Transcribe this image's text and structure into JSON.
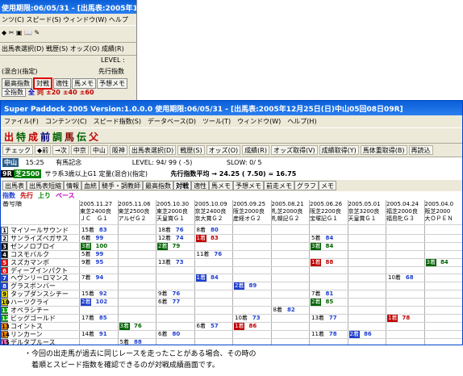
{
  "bg_window": {
    "title": "使用期限:06/05/31 - [出馬表:2005年12",
    "menu": "ンツ(C)  スピード(S)  ウィンドウ(W)  ヘルプ",
    "toolbar": "出馬表選択(D)  戦歴(S)  オッズ(O)  成績(R)",
    "level": "LEVEL :",
    "race_line": "(混合)(指定)",
    "next_line": "先行指数",
    "tabs": [
      "最高指数",
      "対戦",
      "適性",
      "馬メモ",
      "予想メモ"
    ],
    "highlight_tab": "対戦",
    "select_value": "全指数",
    "filter": [
      "全",
      "同",
      "±20",
      "±40",
      "±60"
    ],
    "side_labels": [
      "騎手名",
      "斤量",
      "田勝",
      "57",
      "西"
    ]
  },
  "main_window": {
    "title": "Super Paddock 2005 Version:1.0.0.0 使用期限:06/05/31 - [出馬表:2005年12月25日(日)中山05回08日09R]",
    "menu": [
      "ファイル(F)",
      "コンテンツ(C)",
      "スピード指数(S)",
      "データベース(D)",
      "ツール(T)",
      "ウィンドウ(W)",
      "ヘルプ(H)"
    ],
    "iconbar": [
      "出",
      "特",
      "成",
      "前",
      "調",
      "馬",
      "伝",
      "父"
    ],
    "navbar": [
      "チェック",
      "◆前",
      "→次",
      "中京",
      "中山",
      "阪神",
      "出馬表選択(D)",
      "戦歴(S)",
      "オッズ(O)",
      "成績(R)",
      "オッズ取得(V)",
      "成績取得(Y)",
      "馬体重取得(B)",
      "再読込"
    ],
    "course": "中山",
    "time": "15:25",
    "race_name": "有馬記念",
    "level": "LEVEL:  94/ 99 ( -5)",
    "slow": "SLOW:  0/ 5",
    "race_no": "9R",
    "track": "芝2500",
    "race_desc": "サラ系3歳以上G1 定量(混合)(指定)",
    "pace": "先行指数平均 → 24.25  ( 7.50) = 16.75",
    "tabs": [
      "出馬表",
      "出馬表短縮",
      "情報",
      "血統",
      "騎手・調教師",
      "最高指数",
      "対戦",
      "適性",
      "馬メモ",
      "予想メモ",
      "前走メモ",
      "グラフ",
      "メモ"
    ],
    "active_tab": "対戦",
    "view_modes": [
      "指数",
      "先行",
      "上り",
      "ペース"
    ]
  },
  "grid": {
    "header_label": "番号順",
    "dates": [
      "2005.11.27",
      "2005.11.06",
      "2005.10.30",
      "2005.10.09",
      "2005.09.25",
      "2005.08.21",
      "2005.06.26",
      "2005.05.01",
      "2005.04.24",
      "2005.04.0"
    ],
    "courses": [
      "東芝2400良",
      "東芝2500良",
      "東芝2000良",
      "京芝2400良",
      "阪芝2000良",
      "札芝2000良",
      "阪芝2200良",
      "京芝3200良",
      "福芝2000良",
      "阪芝2000"
    ],
    "races": [
      "ＪＣ　Ｇ１",
      "アルゼＧ２",
      "天皇賞Ｇ１",
      "京大賞Ｇ２",
      "産経オＧ２",
      "札幌記Ｇ２",
      "宝塚記Ｇ１",
      "天皇賞Ｇ１",
      "福島牝Ｇ３",
      "大ＯＰＥＮ"
    ],
    "horses": [
      {
        "num": "1",
        "color": "#ffffff",
        "text": "#000",
        "name": "マイソールサウンド",
        "cells": [
          {
            "col": 0,
            "fin": "15着",
            "spd": "83",
            "cls": ""
          },
          {
            "col": 2,
            "fin": "18着",
            "spd": "76",
            "cls": ""
          },
          {
            "col": 3,
            "fin": "8着",
            "spd": "80",
            "cls": ""
          }
        ]
      },
      {
        "num": "2",
        "color": "#ffffff",
        "text": "#000",
        "name": "サンライズペガサス",
        "cells": [
          {
            "col": 0,
            "fin": "6着",
            "spd": "99",
            "cls": ""
          },
          {
            "col": 2,
            "fin": "12着",
            "spd": "74",
            "cls": ""
          },
          {
            "col": 3,
            "fin": "1着",
            "spd": "83",
            "cls": "r"
          },
          {
            "col": 6,
            "fin": "5着",
            "spd": "84",
            "cls": ""
          }
        ]
      },
      {
        "num": "3",
        "color": "#000000",
        "text": "#fff",
        "name": "ゼンノロブロイ",
        "cells": [
          {
            "col": 0,
            "fin": "3着",
            "spd": "100",
            "cls": "g"
          },
          {
            "col": 2,
            "fin": "2着",
            "spd": "79",
            "cls": "g"
          },
          {
            "col": 6,
            "fin": "3着",
            "spd": "84",
            "cls": "g"
          }
        ]
      },
      {
        "num": "4",
        "color": "#000000",
        "text": "#fff",
        "name": "コスモバルク",
        "cells": [
          {
            "col": 0,
            "fin": "5着",
            "spd": "99",
            "cls": ""
          },
          {
            "col": 3,
            "fin": "11着",
            "spd": "76",
            "cls": ""
          }
        ]
      },
      {
        "num": "5",
        "color": "#e00000",
        "text": "#fff",
        "name": "スズカマンボ",
        "cells": [
          {
            "col": 0,
            "fin": "9着",
            "spd": "95",
            "cls": ""
          },
          {
            "col": 2,
            "fin": "13着",
            "spd": "73",
            "cls": ""
          },
          {
            "col": 6,
            "fin": "1着",
            "spd": "88",
            "cls": "r"
          },
          {
            "col": 9,
            "fin": "3着",
            "spd": "84",
            "cls": "g"
          }
        ]
      },
      {
        "num": "6",
        "color": "#e00000",
        "text": "#fff",
        "name": "ディープインパクト",
        "cells": []
      },
      {
        "num": "7",
        "color": "#1f3fd0",
        "text": "#fff",
        "name": "ヘヴンリーロマンス",
        "cells": [
          {
            "col": 0,
            "fin": "7着",
            "spd": "94",
            "cls": ""
          },
          {
            "col": 3,
            "fin": "1着",
            "spd": "84",
            "cls": "b"
          },
          {
            "col": 8,
            "fin": "10着",
            "spd": "68",
            "cls": ""
          }
        ]
      },
      {
        "num": "8",
        "color": "#1f3fd0",
        "text": "#fff",
        "name": "グラスボンバー",
        "cells": [
          {
            "col": 4,
            "fin": "2着",
            "spd": "89",
            "cls": "b"
          }
        ]
      },
      {
        "num": "9",
        "color": "#f0e000",
        "text": "#000",
        "name": "タップダンスシチー",
        "cells": [
          {
            "col": 0,
            "fin": "15着",
            "spd": "92",
            "cls": ""
          },
          {
            "col": 2,
            "fin": "9着",
            "spd": "76",
            "cls": ""
          },
          {
            "col": 6,
            "fin": "7着",
            "spd": "81",
            "cls": ""
          }
        ]
      },
      {
        "num": "10",
        "color": "#f0e000",
        "text": "#000",
        "name": "ハーツクライ",
        "cells": [
          {
            "col": 0,
            "fin": "2着",
            "spd": "102",
            "cls": "b"
          },
          {
            "col": 2,
            "fin": "6着",
            "spd": "77",
            "cls": ""
          },
          {
            "col": 6,
            "fin": "2着",
            "spd": "85",
            "cls": "g"
          }
        ]
      },
      {
        "num": "11",
        "color": "#00a000",
        "text": "#fff",
        "name": "オペラシチー",
        "cells": [
          {
            "col": 5,
            "fin": "8着",
            "spd": "82",
            "cls": ""
          }
        ]
      },
      {
        "num": "12",
        "color": "#00a000",
        "text": "#fff",
        "name": "ビッグゴールド",
        "cells": [
          {
            "col": 0,
            "fin": "17着",
            "spd": "85",
            "cls": ""
          },
          {
            "col": 4,
            "fin": "10着",
            "spd": "73",
            "cls": ""
          },
          {
            "col": 6,
            "fin": "13着",
            "spd": "77",
            "cls": ""
          },
          {
            "col": 8,
            "fin": "1着",
            "spd": "78",
            "cls": "r"
          }
        ]
      },
      {
        "num": "13",
        "color": "#ff8c00",
        "text": "#000",
        "name": "コイントス",
        "cells": [
          {
            "col": 1,
            "fin": "3着",
            "spd": "76",
            "cls": "g"
          },
          {
            "col": 3,
            "fin": "6着",
            "spd": "57",
            "cls": ""
          },
          {
            "col": 4,
            "fin": "1着",
            "spd": "86",
            "cls": "r"
          }
        ]
      },
      {
        "num": "14",
        "color": "#ff8c00",
        "text": "#000",
        "name": "リンカーン",
        "cells": [
          {
            "col": 0,
            "fin": "14着",
            "spd": "91",
            "cls": ""
          },
          {
            "col": 2,
            "fin": "6着",
            "spd": "80",
            "cls": ""
          },
          {
            "col": 6,
            "fin": "11着",
            "spd": "78",
            "cls": ""
          },
          {
            "col": 7,
            "fin": "2着",
            "spd": "86",
            "cls": "b"
          }
        ]
      },
      {
        "num": "15",
        "color": "#ff77cc",
        "text": "#000",
        "name": "デルタブルース",
        "cells": [
          {
            "col": 1,
            "fin": "5着",
            "spd": "88",
            "cls": ""
          }
        ]
      },
      {
        "num": "16",
        "color": "#ff77cc",
        "text": "#000",
        "name": "オースミハルカ",
        "cells": [
          {
            "col": 8,
            "fin": "4着",
            "spd": "86",
            "cls": ""
          }
        ]
      }
    ]
  },
  "caption": [
    "・今回の出走馬が過去に同じレースを走ったことがある場合、その時の",
    "　着順とスピード指数を確認できるのが対戦成績画面です。"
  ]
}
